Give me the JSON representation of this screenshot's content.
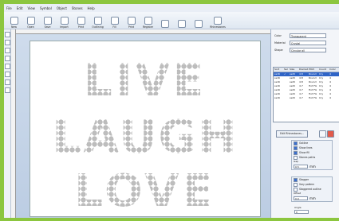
{
  "menu": [
    "File",
    "Edit",
    "View",
    "Symbol",
    "Object",
    "Stones",
    "Help"
  ],
  "toolbar": [
    {
      "label": "New",
      "icon": "new-document-icon"
    },
    {
      "label": "Open",
      "icon": "folder-open-icon"
    },
    {
      "label": "Save",
      "icon": "save-icon"
    },
    {
      "label": "Import",
      "icon": "import-icon"
    },
    {
      "label": "Print",
      "icon": "print-icon"
    },
    {
      "label": "Outlining",
      "icon": "outline-icon"
    },
    {
      "label": "Fill",
      "icon": "fill-icon"
    },
    {
      "label": "Print",
      "icon": "print-icon"
    },
    {
      "label": "Register",
      "icon": "register-icon"
    },
    {
      "label": "",
      "icon": "arrow-left-icon"
    },
    {
      "label": "",
      "icon": "arrow-right-icon"
    },
    {
      "label": "",
      "icon": "zoom-icon"
    },
    {
      "label": "Rhinestones",
      "icon": "rhinestone-icon"
    }
  ],
  "canvas_text": {
    "line1": "LIVE",
    "line2": "LAUGH",
    "line3": "LOVE"
  },
  "panel": {
    "fields": [
      {
        "label": "Color",
        "value": "Transparent"
      },
      {
        "label": "Material",
        "value": "Crystal"
      },
      {
        "label": "Shape",
        "value": "Circular all"
      }
    ],
    "table_headers": [
      "Sort",
      "Sel",
      "Size",
      "Diameter",
      "Pitch",
      "Count",
      "Color"
    ],
    "rows": [
      [
        "ss16",
        "✓",
        "ss20",
        "4.8",
        "Round",
        "Cry",
        "4"
      ],
      [
        "ss16",
        "",
        "ss20",
        "4.8",
        "Round",
        "Cry",
        "4"
      ],
      [
        "ss16",
        "",
        "ss20",
        "4.8",
        "Round",
        "Cry",
        "4"
      ],
      [
        "ss16",
        "",
        "ss20",
        "4.7",
        "Hot Fix",
        "Cry",
        "4"
      ],
      [
        "ss16",
        "",
        "ss20",
        "4.7",
        "Hot Fix",
        "Cry",
        "4"
      ],
      [
        "ss16",
        "",
        "ss20",
        "4.7",
        "Hot Fix",
        "Cry",
        "4"
      ],
      [
        "ss16",
        "",
        "ss20",
        "4.7",
        "Hot Fix",
        "Cry",
        "4"
      ]
    ],
    "edit_button": "Edit Rhinestones...",
    "options1": [
      {
        "label": "Outline",
        "on": true
      },
      {
        "label": "Show lines",
        "on": true
      },
      {
        "label": "Show fill",
        "on": true
      },
      {
        "label": "Stones paths",
        "on": false
      }
    ],
    "gap_label": "Gap",
    "gap_value": "0.5",
    "gap_unit": "mm",
    "options2": [
      {
        "label": "Stagger",
        "on": true
      },
      {
        "label": "Vary pattern",
        "on": false
      },
      {
        "label": "Staggered outline",
        "on": false
      }
    ],
    "offset_label": "Offset",
    "offset_value": "0.0",
    "offset_unit": "mm",
    "angle_label": "Angle",
    "angle_value": "0"
  }
}
